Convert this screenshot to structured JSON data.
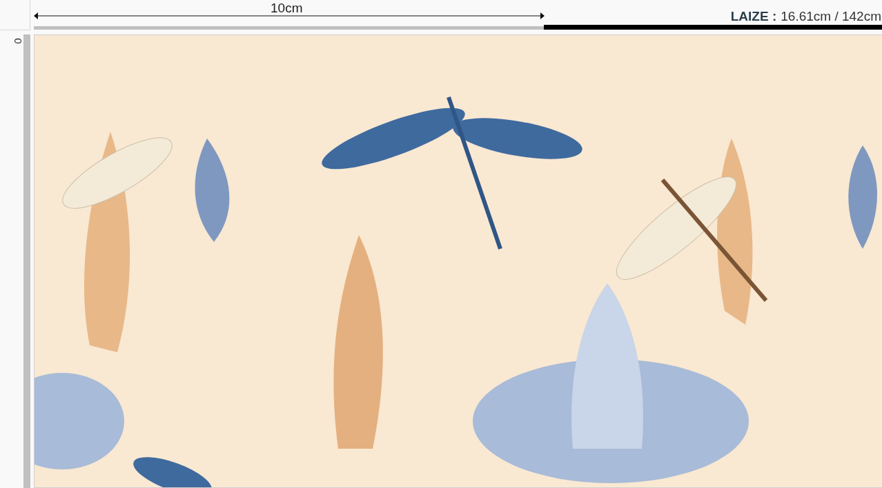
{
  "ruler": {
    "measure_label": "10cm",
    "origin_label": "0"
  },
  "width_info": {
    "label": "LAIZE :",
    "value": "16.61cm / 142cm"
  }
}
